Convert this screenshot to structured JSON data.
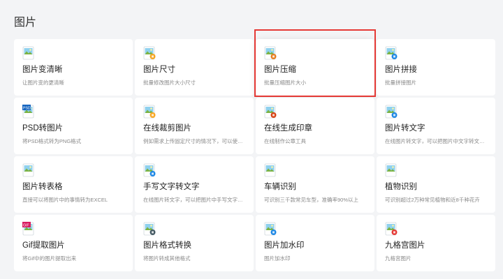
{
  "section": {
    "title": "图片"
  },
  "tools": [
    {
      "name": "图片变清晰",
      "desc": "让图片变的更清晰",
      "icon": "image-enhance-icon",
      "badge": "",
      "badge_color": ""
    },
    {
      "name": "图片尺寸",
      "desc": "批量修改图片大小尺寸",
      "icon": "image-resize-icon",
      "badge": "",
      "badge_color": "#f5a623"
    },
    {
      "name": "图片压缩",
      "desc": "批量压缩图片大小",
      "icon": "image-compress-icon",
      "badge": "",
      "badge_color": "#e67e22"
    },
    {
      "name": "图片拼接",
      "desc": "批量拼接图片",
      "icon": "image-stitch-icon",
      "badge": "",
      "badge_color": "#1e88e5"
    },
    {
      "name": "PSD转图片",
      "desc": "将PSD格式转为PNG格式",
      "icon": "psd-convert-icon",
      "badge": "PSD",
      "badge_color": "#1565c0"
    },
    {
      "name": "在线裁剪图片",
      "desc": "例如需求上传固定尺寸的情况下，可以使用本工...",
      "icon": "image-crop-icon",
      "badge": "",
      "badge_color": "#f9a825"
    },
    {
      "name": "在线生成印章",
      "desc": "在线制作公章工具",
      "icon": "seal-generate-icon",
      "badge": "",
      "badge_color": "#d84315"
    },
    {
      "name": "图片转文字",
      "desc": "在线图片转文字，可以把图片中文字转文本文件...",
      "icon": "image-to-text-icon",
      "badge": "",
      "badge_color": "#1e88e5"
    },
    {
      "name": "图片转表格",
      "desc": "直接可以将图片中的事情转为EXCEL",
      "icon": "image-to-table-icon",
      "badge": "",
      "badge_color": ""
    },
    {
      "name": "手写文字转文字",
      "desc": "在线图片转文字，可以把图片中手写文字转文本...",
      "icon": "handwriting-ocr-icon",
      "badge": "",
      "badge_color": "#1e88e5"
    },
    {
      "name": "车辆识别",
      "desc": "可识别三千款常见车型，准确率90%以上",
      "icon": "vehicle-recognition-icon",
      "badge": "",
      "badge_color": ""
    },
    {
      "name": "植物识别",
      "desc": "可识别超过2万种常见植物和近8千种花卉",
      "icon": "plant-recognition-icon",
      "badge": "",
      "badge_color": ""
    },
    {
      "name": "Gif提取图片",
      "desc": "将Gif中的图片提取出来",
      "icon": "gif-extract-icon",
      "badge": "GIF",
      "badge_color": "#d81b60"
    },
    {
      "name": "图片格式转换",
      "desc": "将图片转成其他格式",
      "icon": "image-format-convert-icon",
      "badge": "",
      "badge_color": "#455a64"
    },
    {
      "name": "图片加水印",
      "desc": "图片加水印",
      "icon": "image-watermark-icon",
      "badge": "",
      "badge_color": "#1e88e5"
    },
    {
      "name": "九格宫图片",
      "desc": "九格宫图片",
      "icon": "nine-grid-image-icon",
      "badge": "",
      "badge_color": "#e53935"
    }
  ],
  "highlighted_index": 2,
  "colors": {
    "highlight_border": "#e53935",
    "icon_sky": "#8fd1ee",
    "icon_grass": "#7cb342",
    "icon_frame": "#cfd8dc"
  }
}
